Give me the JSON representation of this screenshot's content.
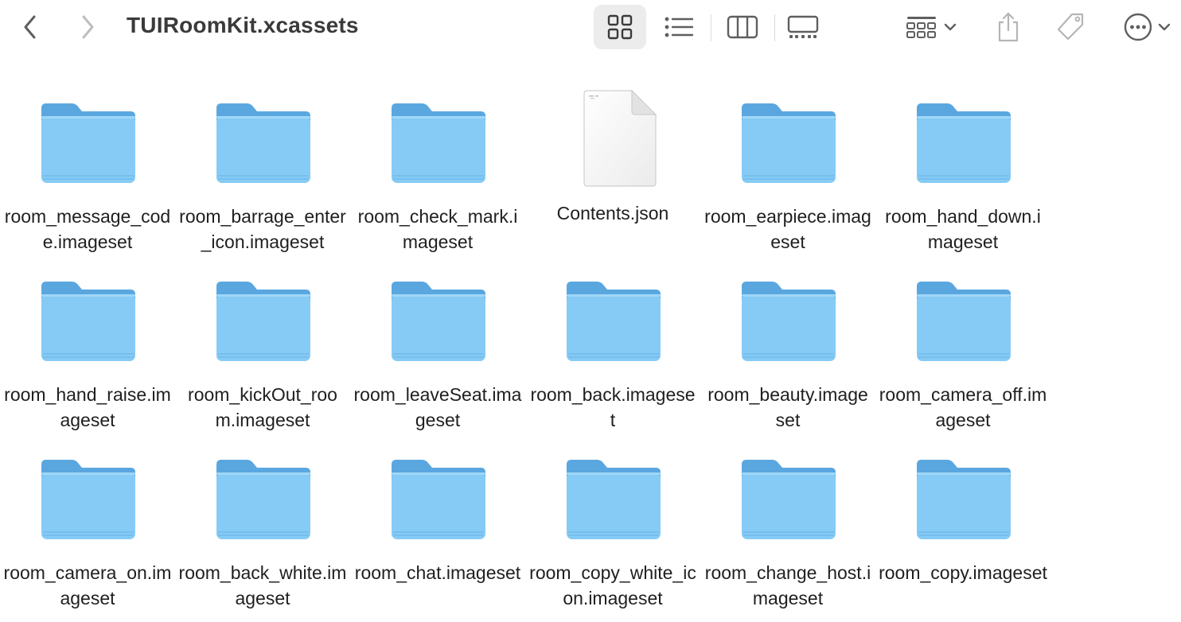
{
  "window": {
    "title": "TUIRoomKit.xcassets"
  },
  "toolbar": {
    "back_icon": "chevron-left-icon",
    "forward_icon": "chevron-right-icon",
    "view_modes": [
      "icon-view",
      "list-view",
      "column-view",
      "gallery-view"
    ],
    "active_view": "icon-view",
    "group_icon": "group-grid-icon",
    "share_icon": "share-icon",
    "tag_icon": "tag-icon",
    "more_icon": "ellipsis-circle-icon"
  },
  "colors": {
    "folder_body": "#86CBF5",
    "folder_tab": "#5AA7E0",
    "toolbar_active_bg": "#ECECEC",
    "icon_gray": "#5F5F5F"
  },
  "items": [
    {
      "label": "room_message_code.imageset",
      "kind": "folder"
    },
    {
      "label": "room_barrage_enter_icon.imageset",
      "kind": "folder"
    },
    {
      "label": "room_check_mark.imageset",
      "kind": "folder"
    },
    {
      "label": "Contents.json",
      "kind": "file"
    },
    {
      "label": "room_earpiece.imageset",
      "kind": "folder"
    },
    {
      "label": "room_hand_down.imageset",
      "kind": "folder"
    },
    {
      "label": "room_hand_raise.imageset",
      "kind": "folder"
    },
    {
      "label": "room_kickOut_room.imageset",
      "kind": "folder"
    },
    {
      "label": "room_leaveSeat.imageset",
      "kind": "folder"
    },
    {
      "label": "room_back.imageset",
      "kind": "folder"
    },
    {
      "label": "room_beauty.imageset",
      "kind": "folder"
    },
    {
      "label": "room_camera_off.imageset",
      "kind": "folder"
    },
    {
      "label": "room_camera_on.imageset",
      "kind": "folder"
    },
    {
      "label": "room_back_white.imageset",
      "kind": "folder"
    },
    {
      "label": "room_chat.imageset",
      "kind": "folder"
    },
    {
      "label": "room_copy_white_icon.imageset",
      "kind": "folder"
    },
    {
      "label": "room_change_host.imageset",
      "kind": "folder"
    },
    {
      "label": "room_copy.imageset",
      "kind": "folder"
    }
  ]
}
